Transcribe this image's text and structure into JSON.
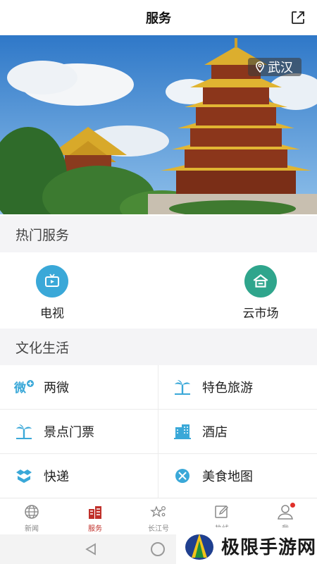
{
  "header": {
    "title": "服务",
    "share_icon": "share-external-icon"
  },
  "banner": {
    "location": "武汉",
    "location_icon": "map-pin-icon"
  },
  "hot_services": {
    "title": "热门服务",
    "items": [
      {
        "label": "电视",
        "icon": "tv-icon",
        "color": "#3aa8d8"
      },
      {
        "label": "云市场",
        "icon": "market-icon",
        "color": "#2fa58c"
      }
    ]
  },
  "culture_life": {
    "title": "文化生活",
    "items": [
      {
        "label": "两微",
        "icon": "weibo-weixin-icon"
      },
      {
        "label": "特色旅游",
        "icon": "palm-tree-icon"
      },
      {
        "label": "景点门票",
        "icon": "palm-tree-icon"
      },
      {
        "label": "酒店",
        "icon": "hotel-building-icon"
      },
      {
        "label": "快递",
        "icon": "package-icon"
      },
      {
        "label": "美食地图",
        "icon": "cutlery-icon"
      }
    ]
  },
  "tabbar": {
    "items": [
      {
        "label": "新闻",
        "icon": "globe-icon",
        "active": false
      },
      {
        "label": "服务",
        "icon": "buildings-icon",
        "active": true
      },
      {
        "label": "长江号",
        "icon": "stars-icon",
        "active": false
      },
      {
        "label": "热线",
        "icon": "edit-icon",
        "active": false
      },
      {
        "label": "我",
        "icon": "user-icon",
        "active": false
      }
    ]
  },
  "watermark": {
    "text": "极限手游网"
  },
  "colors": {
    "accent": "#c0302a",
    "icon_blue": "#3aa8d8",
    "icon_green": "#2fa58c"
  }
}
